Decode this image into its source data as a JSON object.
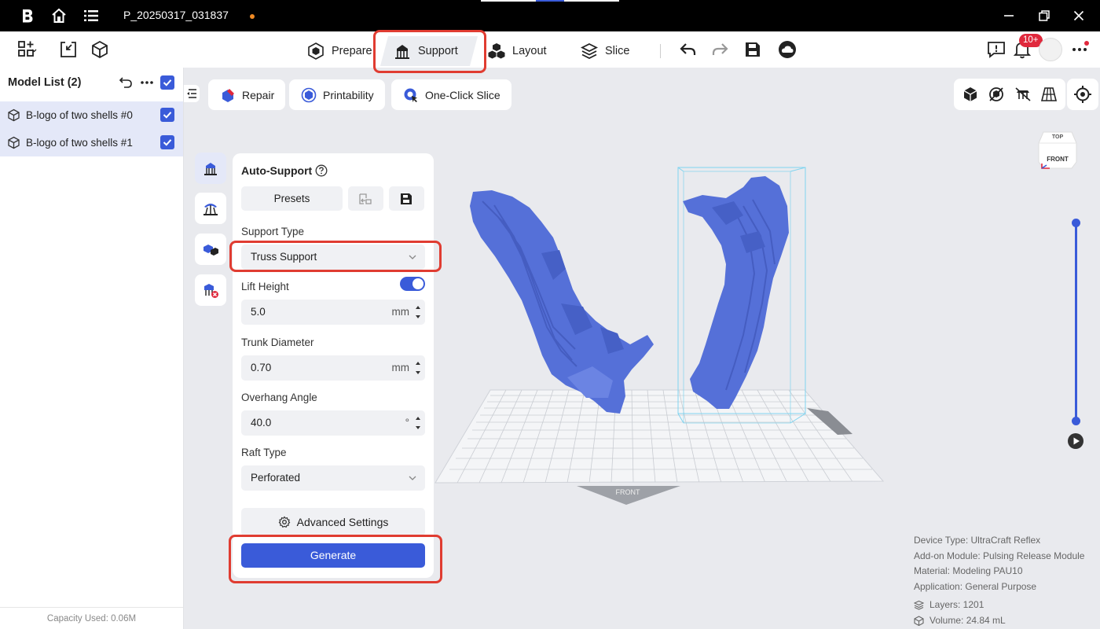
{
  "titlebar": {
    "project_name": "P_20250317_031837"
  },
  "toolbar": {
    "tabs": [
      {
        "label": "Prepare"
      },
      {
        "label": "Support"
      },
      {
        "label": "Layout"
      },
      {
        "label": "Slice"
      }
    ],
    "active_tab": "Support",
    "notification_badge": "10+"
  },
  "sidebar": {
    "title": "Model List (2)",
    "items": [
      {
        "label": "B-logo of two shells #0",
        "checked": true
      },
      {
        "label": "B-logo of two shells #1",
        "checked": true
      }
    ],
    "capacity": "Capacity Used: 0.06M"
  },
  "viewport_toolbar": {
    "repair_label": "Repair",
    "printability_label": "Printability",
    "one_click_label": "One-Click Slice"
  },
  "support_panel": {
    "title": "Auto-Support",
    "presets_label": "Presets",
    "support_type_label": "Support Type",
    "support_type_value": "Truss Support",
    "lift_height_label": "Lift Height",
    "lift_height_enabled": true,
    "lift_height_value": "5.0",
    "lift_height_unit": "mm",
    "trunk_diameter_label": "Trunk Diameter",
    "trunk_diameter_value": "0.70",
    "trunk_diameter_unit": "mm",
    "overhang_angle_label": "Overhang Angle",
    "overhang_angle_value": "40.0",
    "overhang_angle_unit": "°",
    "raft_type_label": "Raft Type",
    "raft_type_value": "Perforated",
    "advanced_label": "Advanced Settings",
    "generate_label": "Generate"
  },
  "viewcube": {
    "top_label": "TOP",
    "front_label": "FRONT"
  },
  "plate": {
    "front_label": "FRONT"
  },
  "device_info": {
    "device_type": "Device Type:  UltraCraft Reflex",
    "addon": "Add-on Module:  Pulsing Release Module",
    "material": "Material:  Modeling PAU10",
    "application": "Application:  General Purpose",
    "layers": "Layers: 1201",
    "volume": "Volume: 24.84 mL"
  },
  "colors": {
    "accent": "#3a5bd9",
    "highlight": "#e03c31",
    "model": "#5570d8"
  }
}
